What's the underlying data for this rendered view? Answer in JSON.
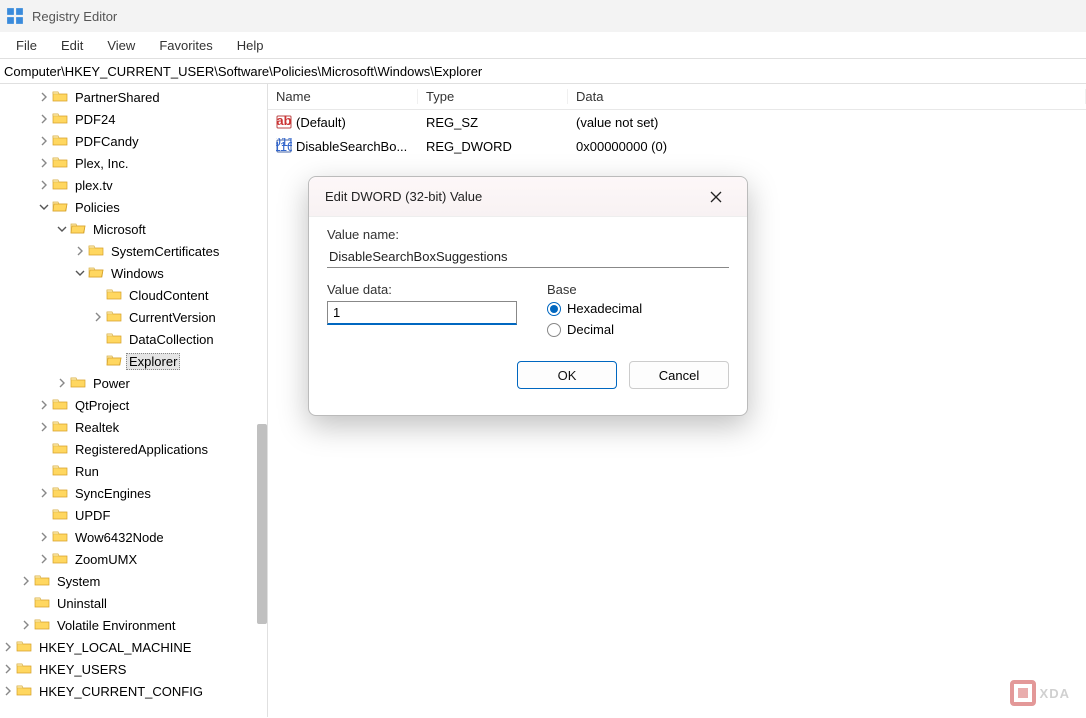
{
  "app": {
    "title": "Registry Editor"
  },
  "menu": [
    "File",
    "Edit",
    "View",
    "Favorites",
    "Help"
  ],
  "address": "Computer\\HKEY_CURRENT_USER\\Software\\Policies\\Microsoft\\Windows\\Explorer",
  "tree": [
    {
      "label": "PartnerShared",
      "indent": 2,
      "exp": false,
      "hasChildren": true
    },
    {
      "label": "PDF24",
      "indent": 2,
      "exp": false,
      "hasChildren": true
    },
    {
      "label": "PDFCandy",
      "indent": 2,
      "exp": false,
      "hasChildren": true
    },
    {
      "label": "Plex, Inc.",
      "indent": 2,
      "exp": false,
      "hasChildren": true
    },
    {
      "label": "plex.tv",
      "indent": 2,
      "exp": false,
      "hasChildren": true
    },
    {
      "label": "Policies",
      "indent": 2,
      "exp": true,
      "hasChildren": true
    },
    {
      "label": "Microsoft",
      "indent": 3,
      "exp": true,
      "hasChildren": true
    },
    {
      "label": "SystemCertificates",
      "indent": 4,
      "exp": false,
      "hasChildren": true
    },
    {
      "label": "Windows",
      "indent": 4,
      "exp": true,
      "hasChildren": true
    },
    {
      "label": "CloudContent",
      "indent": 5,
      "exp": false,
      "hasChildren": false
    },
    {
      "label": "CurrentVersion",
      "indent": 5,
      "exp": false,
      "hasChildren": true
    },
    {
      "label": "DataCollection",
      "indent": 5,
      "exp": false,
      "hasChildren": false
    },
    {
      "label": "Explorer",
      "indent": 5,
      "exp": false,
      "hasChildren": false,
      "selected": true
    },
    {
      "label": "Power",
      "indent": 3,
      "exp": false,
      "hasChildren": true
    },
    {
      "label": "QtProject",
      "indent": 2,
      "exp": false,
      "hasChildren": true
    },
    {
      "label": "Realtek",
      "indent": 2,
      "exp": false,
      "hasChildren": true
    },
    {
      "label": "RegisteredApplications",
      "indent": 2,
      "exp": false,
      "hasChildren": false
    },
    {
      "label": "Run",
      "indent": 2,
      "exp": false,
      "hasChildren": false
    },
    {
      "label": "SyncEngines",
      "indent": 2,
      "exp": false,
      "hasChildren": true
    },
    {
      "label": "UPDF",
      "indent": 2,
      "exp": false,
      "hasChildren": false
    },
    {
      "label": "Wow6432Node",
      "indent": 2,
      "exp": false,
      "hasChildren": true
    },
    {
      "label": "ZoomUMX",
      "indent": 2,
      "exp": false,
      "hasChildren": true
    },
    {
      "label": "System",
      "indent": 1,
      "exp": false,
      "hasChildren": true
    },
    {
      "label": "Uninstall",
      "indent": 1,
      "exp": false,
      "hasChildren": false
    },
    {
      "label": "Volatile Environment",
      "indent": 1,
      "exp": false,
      "hasChildren": true
    },
    {
      "label": "HKEY_LOCAL_MACHINE",
      "indent": 0,
      "exp": false,
      "hasChildren": true
    },
    {
      "label": "HKEY_USERS",
      "indent": 0,
      "exp": false,
      "hasChildren": true
    },
    {
      "label": "HKEY_CURRENT_CONFIG",
      "indent": 0,
      "exp": false,
      "hasChildren": true
    }
  ],
  "list": {
    "columns": {
      "name": "Name",
      "type": "Type",
      "data": "Data"
    },
    "rows": [
      {
        "name": "(Default)",
        "type": "REG_SZ",
        "data": "(value not set)",
        "iconKind": "sz"
      },
      {
        "name": "DisableSearchBo...",
        "type": "REG_DWORD",
        "data": "0x00000000 (0)",
        "iconKind": "dword"
      }
    ]
  },
  "dialog": {
    "title": "Edit DWORD (32-bit) Value",
    "valueNameLabel": "Value name:",
    "valueName": "DisableSearchBoxSuggestions",
    "valueDataLabel": "Value data:",
    "valueData": "1",
    "baseLabel": "Base",
    "baseOptions": {
      "hex": "Hexadecimal",
      "dec": "Decimal"
    },
    "baseSelected": "hex",
    "ok": "OK",
    "cancel": "Cancel"
  },
  "watermark": "XDA"
}
